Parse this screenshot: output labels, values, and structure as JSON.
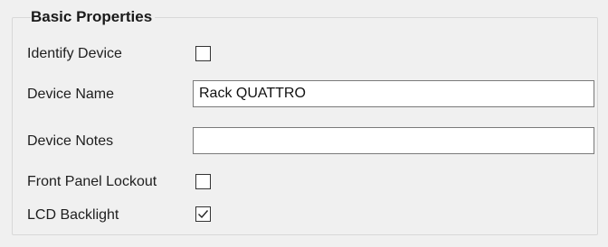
{
  "group": {
    "title": "Basic Properties"
  },
  "identify_device": {
    "label": "Identify Device",
    "checked": false
  },
  "device_name": {
    "label": "Device Name",
    "value": "Rack QUATTRO"
  },
  "device_notes": {
    "label": "Device Notes",
    "value": ""
  },
  "front_panel_lockout": {
    "label": "Front Panel Lockout",
    "checked": false
  },
  "lcd_backlight": {
    "label": "LCD Backlight",
    "checked": true
  }
}
